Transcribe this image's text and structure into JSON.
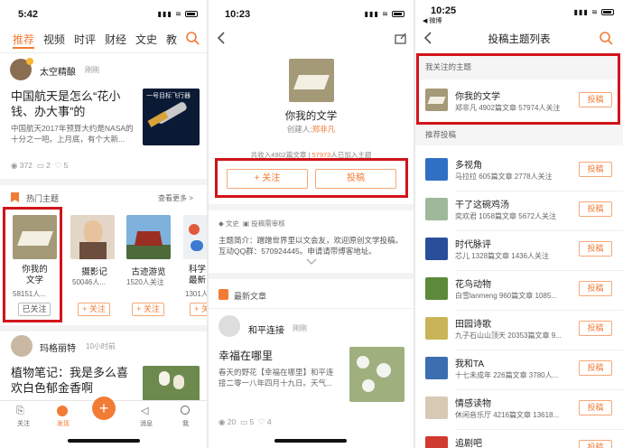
{
  "panel1": {
    "time": "5:42",
    "tabs": [
      "推荐",
      "视频",
      "时评",
      "财经",
      "文史",
      "教"
    ],
    "post1": {
      "author": "太空精酿",
      "time": "刚刚",
      "title": "中国航天是怎么“花小钱、办大事”的",
      "excerpt": "中国航天2017年预算大约是NASA的十分之一吧。上月底，有个大新...",
      "thumb_text": "一号目标飞行器",
      "views": "372",
      "comments": "2",
      "likes": "5"
    },
    "hot": {
      "title": "热门主题",
      "more": "查看更多 >",
      "cards": [
        {
          "name1": "你我的",
          "name2": "文学",
          "count": "58151人...",
          "button": "已关注"
        },
        {
          "name1": "摄影记",
          "name2": "",
          "count": "50046人...",
          "button": "+ 关注"
        },
        {
          "name1": "古迹游览",
          "name2": "",
          "count": "1520人关注",
          "button": "+ 关注"
        },
        {
          "name1": "科学",
          "name2": "最新",
          "count": "1301人",
          "button": "+ 关注"
        }
      ]
    },
    "post2": {
      "author": "玛格丽特",
      "time": "10小时前",
      "title": "植物笔记：我是多么喜欢白色郁金香啊"
    },
    "bottom_nav": [
      "关注",
      "发现",
      "消息",
      "我"
    ]
  },
  "panel2": {
    "time": "10:23",
    "topic_name": "你我的文学",
    "creator_label": "创建人:",
    "creator": "郑非凡",
    "stats_prefix": "共收入4902篇文章",
    "stats_sep": "|",
    "stats_count": "57973",
    "stats_suffix": "人已加入主题",
    "follow_button": "+ 关注",
    "submit_button": "投稿",
    "tags": [
      "文史",
      "投稿需审核"
    ],
    "intro": "主题简介：蹭蹭世界里以文会友，欢迎原创文学投稿。互动QQ群：570924445。申请请带博客地址。",
    "latest_title": "最新文章",
    "article": {
      "author": "和平连接",
      "time": "刚刚",
      "title": "幸福在哪里",
      "excerpt": "春天的野花【幸福在哪里】和平连接二零一八年四月十九日。天气...",
      "views": "20",
      "comments": "5",
      "likes": "4"
    }
  },
  "panel3": {
    "time": "10:25",
    "back_app": "◀ 微博",
    "title": "投稿主题列表",
    "followed_header": "我关注的主题",
    "followed": {
      "name": "你我的文学",
      "sub": "郑非凡 4902篇文章 57974人关注",
      "button": "投稿"
    },
    "recommended_header": "推荐投稿",
    "items": [
      {
        "name": "多视角",
        "sub": "马拉拉 605篇文章 2778人关注",
        "button": "投稿",
        "color": "#2f6fc4"
      },
      {
        "name": "干了这碗鸡汤",
        "sub": "奕欢君 1058篇文章 5672人关注",
        "button": "投稿",
        "color": "#9fb89a"
      },
      {
        "name": "时代脉评",
        "sub": "芯儿 1328篇文章 1436人关注",
        "button": "投稿",
        "color": "#2a4f9a"
      },
      {
        "name": "花鸟动物",
        "sub": "白雪lanmeng 960篇文章 1085...",
        "button": "投稿",
        "color": "#5c8a3a"
      },
      {
        "name": "田园诗歌",
        "sub": "九子石山山顶天 20353篇文章 9...",
        "button": "投稿",
        "color": "#c9b458"
      },
      {
        "name": "我和TA",
        "sub": "十七未成年 226篇文章 3780人...",
        "button": "投稿",
        "color": "#3b6fb0"
      },
      {
        "name": "情感读物",
        "sub": "休闲音乐厅 4216篇文章 13618...",
        "button": "投稿",
        "color": "#d8c9b4"
      },
      {
        "name": "追剧吧",
        "sub": "",
        "button": "投稿",
        "color": "#d13a2f"
      }
    ]
  }
}
